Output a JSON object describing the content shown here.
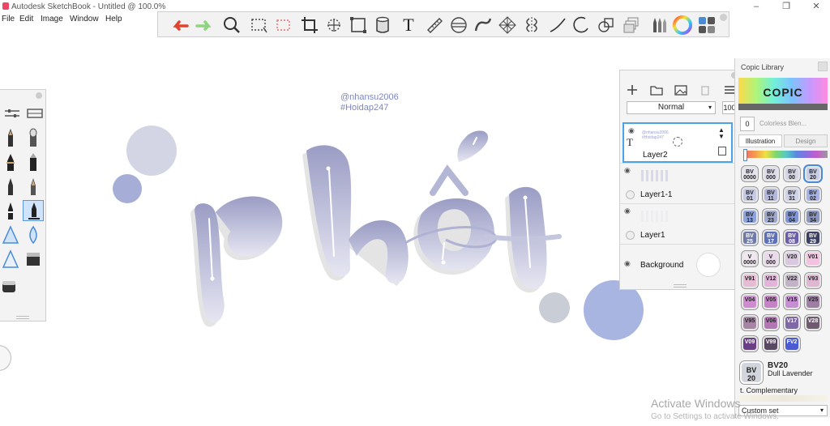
{
  "window": {
    "title": "Autodesk SketchBook - Untitled @ 100.0%",
    "minimize": "–",
    "maximize": "❐",
    "close": "✕"
  },
  "menu": [
    "File",
    "Edit",
    "Image",
    "Window",
    "Help"
  ],
  "toolbar": {
    "text_tool_glyph": "T",
    "icons": [
      "undo-icon",
      "redo-icon",
      "zoom-icon",
      "rect-select-icon",
      "lasso-select-icon",
      "crop-icon",
      "transform-icon",
      "distort-icon",
      "fill-icon",
      "text-icon",
      "ruler-icon",
      "ellipse-guide-icon",
      "french-curve-icon",
      "perspective-icon",
      "symmetry-icon",
      "stroke-icon",
      "predictive-stroke-icon",
      "shapes-icon",
      "layer-icon",
      "copic-icon",
      "color-wheel-icon",
      "brush-library-icon"
    ]
  },
  "canvas": {
    "credit_line1": "@nhansu2006",
    "credit_line2": "#Hoidap247",
    "colors": {
      "lettering_top": "#9a9cc4",
      "lettering_bottom": "#e6e6f2",
      "shadow": "#e4e4e4",
      "circle_light": "#d4d5e4",
      "circle_blue": "#a6aed8",
      "circle_gray": "#c9ced6",
      "circle_big": "#a8b5e0"
    }
  },
  "layer_editor": {
    "blend_mode": "Normal",
    "opacity": "100",
    "blend_arrow": "▾",
    "layers": [
      {
        "name": "Layer2",
        "selected": true,
        "thumb_line1": "@nhansu2006",
        "thumb_line2": "#Hoidap247",
        "type_glyph": "T"
      },
      {
        "name": "Layer1-1",
        "selected": false
      },
      {
        "name": "Layer1",
        "selected": false
      },
      {
        "name": "Background",
        "selected": false
      }
    ],
    "eye_glyph": "◉"
  },
  "copic": {
    "title": "Copic Library",
    "logo": "COPIC",
    "colorless_num": "0",
    "colorless_label": "Colorless Blen...",
    "tabs": [
      "Illustration",
      "Design"
    ],
    "active_tab": "Illustration",
    "swatches": [
      {
        "code": "BV 0000",
        "color": "#e4e4ef"
      },
      {
        "code": "BV 000",
        "color": "#dcdcec"
      },
      {
        "code": "BV 00",
        "color": "#d5d5e8"
      },
      {
        "code": "BV 20",
        "color": "#c8cde8"
      },
      {
        "code": "BV 01",
        "color": "#c5c9e6"
      },
      {
        "code": "BV 11",
        "color": "#b3b7dc"
      },
      {
        "code": "BV 31",
        "color": "#cfd3ea"
      },
      {
        "code": "BV 02",
        "color": "#a7b3e4"
      },
      {
        "code": "BV 13",
        "color": "#8da3dd"
      },
      {
        "code": "BV 23",
        "color": "#9fa9ce"
      },
      {
        "code": "BV 04",
        "color": "#7f95d8"
      },
      {
        "code": "BV 34",
        "color": "#8c96bf"
      },
      {
        "code": "BV 25",
        "color": "#6f7ba6"
      },
      {
        "code": "BV 17",
        "color": "#5e70b8"
      },
      {
        "code": "BV 08",
        "color": "#6c5ea8"
      },
      {
        "code": "BV 29",
        "color": "#3d3f60"
      },
      {
        "code": "V 0000",
        "color": "#f1e7ef"
      },
      {
        "code": "V 000",
        "color": "#ead9ea"
      },
      {
        "code": "V20",
        "color": "#d9c8df"
      },
      {
        "code": "V01",
        "color": "#f2c2e0"
      },
      {
        "code": "V91",
        "color": "#e6bcd4"
      },
      {
        "code": "V12",
        "color": "#e3b4da"
      },
      {
        "code": "V22",
        "color": "#c2b3c6"
      },
      {
        "code": "V93",
        "color": "#e0b7d3"
      },
      {
        "code": "V04",
        "color": "#cf8bd0"
      },
      {
        "code": "V05",
        "color": "#c582c7"
      },
      {
        "code": "V15",
        "color": "#c78fd3"
      },
      {
        "code": "V25",
        "color": "#9d7fa4"
      },
      {
        "code": "V95",
        "color": "#a884a4"
      },
      {
        "code": "V06",
        "color": "#b276b4"
      },
      {
        "code": "V17",
        "color": "#8067a6"
      },
      {
        "code": "V28",
        "color": "#6e5b70"
      },
      {
        "code": "V09",
        "color": "#6b3f88"
      },
      {
        "code": "V99",
        "color": "#5b4864"
      },
      {
        "code": "FV2",
        "color": "#4a5cd4"
      }
    ],
    "current": {
      "code": "BV20",
      "swatch_label": "BV 20",
      "name": "Dull Lavender"
    },
    "complementary": "t. Complementary",
    "custom_set": "Custom set"
  },
  "watermark": {
    "line1": "Activate Windows",
    "line2": "Go to Settings to activate Windows."
  }
}
